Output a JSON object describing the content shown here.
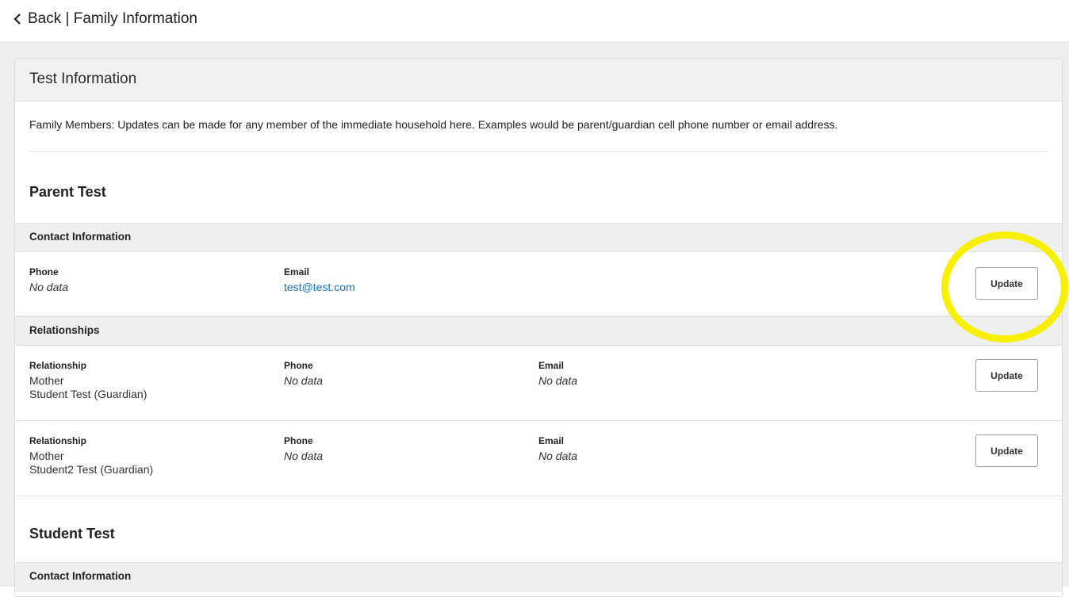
{
  "header": {
    "back_label": "Back | Family Information"
  },
  "card": {
    "title": "Test Information",
    "intro": "Family Members: Updates can be made for any member of the immediate household here. Examples would be parent/guardian cell phone number or email address."
  },
  "parent": {
    "name": "Parent Test",
    "contact_heading": "Contact Information",
    "contact": {
      "phone_label": "Phone",
      "phone_value": "No data",
      "email_label": "Email",
      "email_value": "test@test.com",
      "update_label": "Update"
    },
    "relationships_heading": "Relationships",
    "relationships": [
      {
        "relationship_label": "Relationship",
        "relationship_line1": "Mother",
        "relationship_line2": "Student Test (Guardian)",
        "phone_label": "Phone",
        "phone_value": "No data",
        "email_label": "Email",
        "email_value": "No data",
        "update_label": "Update"
      },
      {
        "relationship_label": "Relationship",
        "relationship_line1": "Mother",
        "relationship_line2": "Student2 Test (Guardian)",
        "phone_label": "Phone",
        "phone_value": "No data",
        "email_label": "Email",
        "email_value": "No data",
        "update_label": "Update"
      }
    ]
  },
  "student": {
    "name": "Student Test",
    "contact_heading": "Contact Information"
  },
  "colors": {
    "highlight": "#f7f100",
    "link": "#1a73c8"
  },
  "icons": {
    "back": "chevron-left-icon"
  }
}
